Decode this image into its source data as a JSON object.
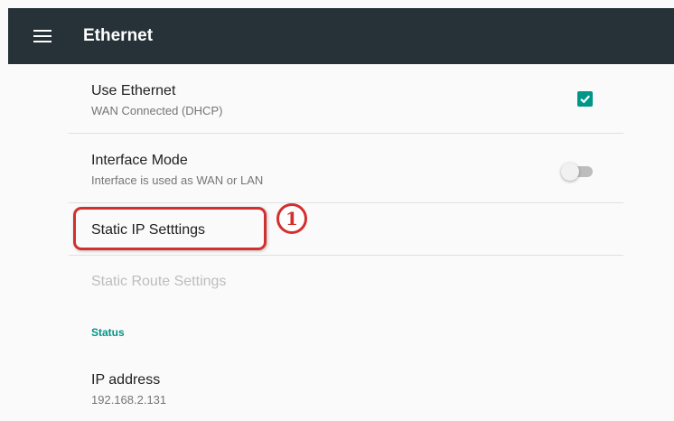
{
  "header": {
    "title": "Ethernet",
    "menu_icon": "hamburger-menu-icon",
    "background": "#263238"
  },
  "settings": [
    {
      "title": "Use Ethernet",
      "summary": "WAN Connected (DHCP)",
      "control": "checkbox",
      "checked": true
    },
    {
      "title": "Interface Mode",
      "summary": "Interface is used as WAN or LAN",
      "control": "switch",
      "on": false
    },
    {
      "title": "Static IP Setttings"
    },
    {
      "title": "Static Route Settings",
      "disabled": true
    }
  ],
  "status": {
    "header": "Status",
    "ip_address": {
      "title": "IP address",
      "value": "192.168.2.131"
    }
  },
  "annotation": {
    "number": "1",
    "color": "#d32f2f"
  },
  "accent_color": "#009688"
}
